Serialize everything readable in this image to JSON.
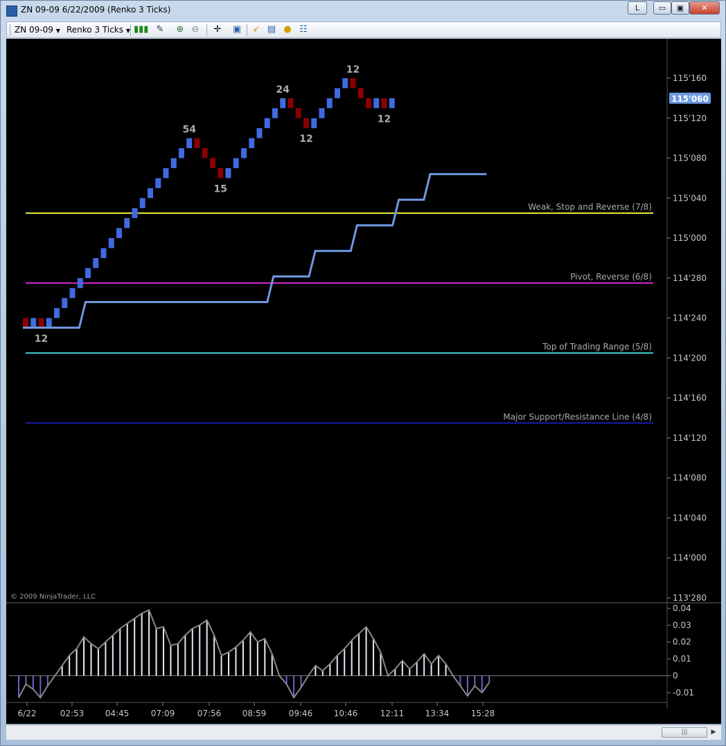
{
  "window": {
    "title": "ZN 09-09  6/22/2009 (Renko 3 Ticks)",
    "l_button": "L",
    "minimize_glyph": "▭",
    "maximize_glyph": "▣",
    "close_glyph": "✕"
  },
  "toolbar": {
    "instrument": "ZN 09-09",
    "period": "Renko 3 Ticks",
    "icons": [
      "candlestick-icon",
      "pencil-icon",
      "zoom-in-icon",
      "zoom-out-icon",
      "crosshair-icon",
      "properties-icon",
      "open-icon",
      "indicators-icon",
      "strategy-icon",
      "data-box-icon"
    ]
  },
  "colors": {
    "up_brick": "#4169e1",
    "down_brick": "#8b0000",
    "line_7_8": "#e8e83a",
    "line_6_8": "#d82ad8",
    "line_5_8": "#3ed4d4",
    "line_4_8": "#1a1ab0",
    "stair_line": "#6f98e0",
    "axis_text": "#c8c8c8",
    "last_price_bg": "#6f98e0"
  },
  "chart_data": [
    {
      "type": "renko",
      "y_axis_labels": [
        "115'160",
        "115'120",
        "115'080",
        "115'040",
        "115'000",
        "114'280",
        "114'240",
        "114'200",
        "114'160",
        "114'120",
        "114'080",
        "114'040",
        "114'000",
        "113'280"
      ],
      "last_price": "115'060",
      "murrey_lines": [
        {
          "label": "Weak, Stop and Reverse (7/8)",
          "value": 115.078125
        },
        {
          "label": "Pivot, Reverse (6/8)",
          "value": 114.859375
        },
        {
          "label": "Top of Trading Range (5/8)",
          "value": 114.640625
        },
        {
          "label": "Major Support/Resistance Line (4/8)",
          "value": 114.421875
        }
      ],
      "swing_labels": [
        {
          "text": "12",
          "index": 2,
          "at": "below"
        },
        {
          "text": "54",
          "index": 21,
          "at": "above"
        },
        {
          "text": "15",
          "index": 25,
          "at": "below"
        },
        {
          "text": "24",
          "index": 33,
          "at": "above"
        },
        {
          "text": "12",
          "index": 36,
          "at": "below"
        },
        {
          "text": "12",
          "index": 42,
          "at": "above"
        },
        {
          "text": "12",
          "index": 46,
          "at": "below"
        }
      ],
      "bricks": [
        {
          "dir": "down",
          "open": 114.75,
          "close": 114.71875
        },
        {
          "dir": "up",
          "open": 114.71875,
          "close": 114.75
        },
        {
          "dir": "down",
          "open": 114.75,
          "close": 114.71875
        },
        {
          "dir": "up",
          "open": 114.71875,
          "close": 114.75
        },
        {
          "dir": "up",
          "open": 114.75,
          "close": 114.78125
        },
        {
          "dir": "up",
          "open": 114.78125,
          "close": 114.8125
        },
        {
          "dir": "up",
          "open": 114.8125,
          "close": 114.84375
        },
        {
          "dir": "up",
          "open": 114.84375,
          "close": 114.875
        },
        {
          "dir": "up",
          "open": 114.875,
          "close": 114.90625
        },
        {
          "dir": "up",
          "open": 114.90625,
          "close": 114.9375
        },
        {
          "dir": "up",
          "open": 114.9375,
          "close": 114.96875
        },
        {
          "dir": "up",
          "open": 114.96875,
          "close": 115.0
        },
        {
          "dir": "up",
          "open": 115.0,
          "close": 115.03125
        },
        {
          "dir": "up",
          "open": 115.03125,
          "close": 115.0625
        },
        {
          "dir": "up",
          "open": 115.0625,
          "close": 115.09375
        },
        {
          "dir": "up",
          "open": 115.09375,
          "close": 115.125
        },
        {
          "dir": "up",
          "open": 115.125,
          "close": 115.15625
        },
        {
          "dir": "up",
          "open": 115.15625,
          "close": 115.1875
        },
        {
          "dir": "up",
          "open": 115.1875,
          "close": 115.21875
        },
        {
          "dir": "up",
          "open": 115.21875,
          "close": 115.25
        },
        {
          "dir": "up",
          "open": 115.25,
          "close": 115.28125
        },
        {
          "dir": "up",
          "open": 115.28125,
          "close": 115.3125
        },
        {
          "dir": "down",
          "open": 115.3125,
          "close": 115.28125
        },
        {
          "dir": "down",
          "open": 115.28125,
          "close": 115.25
        },
        {
          "dir": "down",
          "open": 115.25,
          "close": 115.21875
        },
        {
          "dir": "down",
          "open": 115.21875,
          "close": 115.1875
        },
        {
          "dir": "up",
          "open": 115.1875,
          "close": 115.21875
        },
        {
          "dir": "up",
          "open": 115.21875,
          "close": 115.25
        },
        {
          "dir": "up",
          "open": 115.25,
          "close": 115.28125
        },
        {
          "dir": "up",
          "open": 115.28125,
          "close": 115.3125
        },
        {
          "dir": "up",
          "open": 115.3125,
          "close": 115.34375
        },
        {
          "dir": "up",
          "open": 115.34375,
          "close": 115.375
        },
        {
          "dir": "up",
          "open": 115.375,
          "close": 115.40625
        },
        {
          "dir": "up",
          "open": 115.40625,
          "close": 115.4375
        },
        {
          "dir": "down",
          "open": 115.4375,
          "close": 115.40625
        },
        {
          "dir": "down",
          "open": 115.40625,
          "close": 115.375
        },
        {
          "dir": "down",
          "open": 115.375,
          "close": 115.34375
        },
        {
          "dir": "up",
          "open": 115.34375,
          "close": 115.375
        },
        {
          "dir": "up",
          "open": 115.375,
          "close": 115.40625
        },
        {
          "dir": "up",
          "open": 115.40625,
          "close": 115.4375
        },
        {
          "dir": "up",
          "open": 115.4375,
          "close": 115.46875
        },
        {
          "dir": "up",
          "open": 115.46875,
          "close": 115.5
        },
        {
          "dir": "down",
          "open": 115.5,
          "close": 115.46875
        },
        {
          "dir": "down",
          "open": 115.46875,
          "close": 115.4375
        },
        {
          "dir": "down",
          "open": 115.4375,
          "close": 115.40625
        },
        {
          "dir": "up",
          "open": 115.40625,
          "close": 115.4375
        },
        {
          "dir": "down",
          "open": 115.4375,
          "close": 115.40625
        },
        {
          "dir": "up",
          "open": 115.40625,
          "close": 115.4375
        }
      ],
      "stair_line": [
        {
          "x0": 0,
          "x1": 5,
          "value": 114.72
        },
        {
          "x0": 6,
          "x1": 23,
          "value": 114.8
        },
        {
          "x0": 24,
          "x1": 27,
          "value": 114.88
        },
        {
          "x0": 28,
          "x1": 31,
          "value": 114.96
        },
        {
          "x0": 32,
          "x1": 35,
          "value": 115.04
        },
        {
          "x0": 36,
          "x1": 38,
          "value": 115.12
        },
        {
          "x0": 39,
          "x1": 44,
          "value": 115.2
        }
      ]
    },
    {
      "type": "histogram",
      "y_axis_labels": [
        "0.04",
        "0.03",
        "0.02",
        "0.01",
        "0",
        "-0.01"
      ],
      "ylim": [
        -0.015,
        0.04
      ],
      "x_tick_labels": [
        "6/22",
        "02:53",
        "04:45",
        "07:09",
        "07:56",
        "08:59",
        "09:46",
        "10:46",
        "12:11",
        "13:34",
        "15:28"
      ],
      "values": [
        -0.013,
        -0.005,
        -0.008,
        -0.013,
        -0.006,
        0.0,
        0.006,
        0.012,
        0.016,
        0.023,
        0.019,
        0.016,
        0.02,
        0.024,
        0.028,
        0.031,
        0.034,
        0.037,
        0.039,
        0.028,
        0.029,
        0.018,
        0.019,
        0.024,
        0.028,
        0.03,
        0.033,
        0.024,
        0.012,
        0.014,
        0.017,
        0.021,
        0.026,
        0.02,
        0.022,
        0.013,
        0.0,
        -0.005,
        -0.013,
        -0.007,
        0.0,
        0.006,
        0.003,
        0.007,
        0.012,
        0.016,
        0.021,
        0.025,
        0.029,
        0.022,
        0.014,
        0.0,
        0.004,
        0.009,
        0.004,
        0.008,
        0.013,
        0.007,
        0.012,
        0.007,
        0.0,
        -0.006,
        -0.012,
        -0.006,
        -0.01,
        -0.004
      ]
    }
  ],
  "copyright": "© 2009 NinjaTrader, LLC"
}
